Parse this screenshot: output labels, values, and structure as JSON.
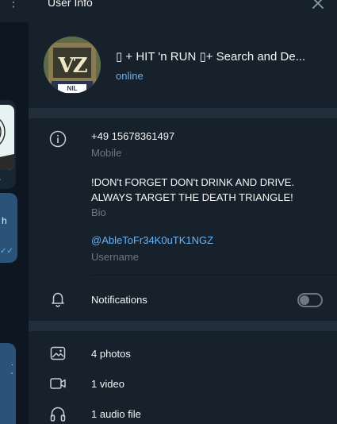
{
  "panel": {
    "title": "User Info"
  },
  "profile": {
    "name": "▯ + HIT 'n RUN ▯+ Search and De...",
    "status": "online",
    "avatar_letters": "VZ",
    "avatar_tag": "NIL"
  },
  "info": {
    "phone": "+49 15678361497",
    "phone_label": "Mobile",
    "bio": "!DON't FORGET DON't DRINK AND DRIVE. ALWAYS TARGET THE DEATH TRIANGLE!",
    "bio_label": "Bio",
    "username": "@AbleToFr34K0uTK1NGZ",
    "username_label": "Username"
  },
  "notifications": {
    "label": "Notifications",
    "enabled": false
  },
  "media": [
    {
      "label": "4 photos",
      "icon": "photo-icon"
    },
    {
      "label": "1 video",
      "icon": "video-icon"
    },
    {
      "label": "1 audio file",
      "icon": "headphones-icon"
    }
  ],
  "chat_sliver": {
    "fragment": "h"
  },
  "colors": {
    "background": "#17212b",
    "divider": "#232e3c",
    "accent": "#6ab3f3",
    "muted": "#6d7883",
    "outgoing_bubble": "#2b5278"
  }
}
